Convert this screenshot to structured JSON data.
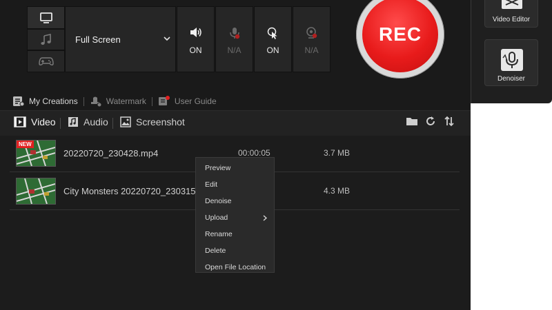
{
  "capture": {
    "mode_dropdown": {
      "selected": "Full Screen"
    },
    "toggles": [
      {
        "id": "system-audio",
        "state": "ON",
        "icon": "speaker-icon",
        "enabled": true
      },
      {
        "id": "microphone",
        "state": "N/A",
        "icon": "microphone-off-icon",
        "enabled": false
      },
      {
        "id": "mouse-click",
        "state": "ON",
        "icon": "cursor-click-icon",
        "enabled": true
      },
      {
        "id": "webcam",
        "state": "N/A",
        "icon": "webcam-off-icon",
        "enabled": false
      }
    ],
    "rec_label": "REC",
    "rec_color": "#e81b1b"
  },
  "links": {
    "my_creations": "My Creations",
    "watermark": "Watermark",
    "user_guide": "User Guide"
  },
  "tabs": [
    {
      "label": "Video",
      "active": true
    },
    {
      "label": "Audio",
      "active": false
    },
    {
      "label": "Screenshot",
      "active": false
    }
  ],
  "files": [
    {
      "name": "20220720_230428.mp4",
      "duration": "00:00:05",
      "size": "3.7 MB",
      "badge": "NEW"
    },
    {
      "name": "City Monsters 20220720_230315....",
      "duration": "",
      "size": "4.3 MB",
      "badge": ""
    }
  ],
  "context_menu": [
    {
      "label": "Preview"
    },
    {
      "label": "Edit"
    },
    {
      "label": "Denoise"
    },
    {
      "label": "Upload",
      "submenu": true
    },
    {
      "label": "Rename"
    },
    {
      "label": "Delete"
    },
    {
      "label": "Open File Location"
    }
  ],
  "side_tools": {
    "video_editor": "Video Editor",
    "denoiser": "Denoiser"
  }
}
